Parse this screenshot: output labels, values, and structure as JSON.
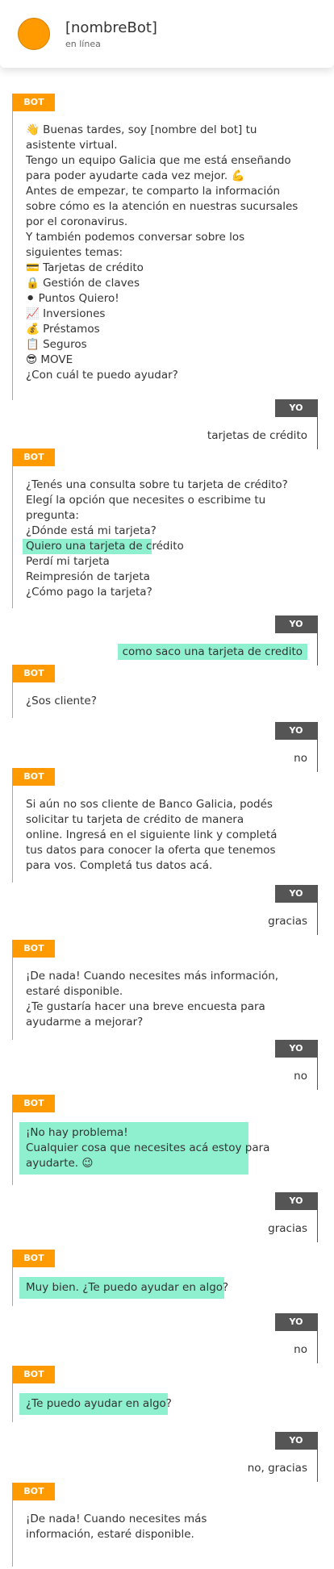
{
  "header": {
    "bot_name": "[nombreBot]",
    "status": "en línea"
  },
  "labels": {
    "bot": "BOT",
    "user": "YO"
  },
  "messages": {
    "m1": {
      "lines": [
        "👋 Buenas tardes, soy [nombre del bot] tu",
        "asistente virtual.",
        "Tengo un equipo Galicia que me está enseñando",
        "para poder ayudarte cada vez mejor. 💪",
        "Antes de empezar, te comparto la información",
        "sobre cómo es la atención en nuestras sucursales",
        "por el coronavirus.",
        "Y también podemos conversar sobre los",
        "siguientes temas:",
        "💳 Tarjetas de crédito",
        "🔒 Gestión de claves",
        "⚫ Puntos Quiero!",
        "📈 Inversiones",
        "💰 Préstamos",
        "📋 Seguros",
        "😎 MOVE",
        "¿Con cuál te puedo ayudar?"
      ]
    },
    "u1": {
      "text": "tarjetas de crédito"
    },
    "m2": {
      "lines": [
        "¿Tenés una consulta sobre tu tarjeta de crédito?",
        "Elegí la opción que necesites o escribime tu",
        "pregunta:",
        "¿Dónde está mi tarjeta?",
        "Quiero una tarjeta de crédito",
        "Perdí mi tarjeta",
        "Reimpresión de tarjeta",
        "¿Cómo pago la tarjeta?"
      ]
    },
    "u2": {
      "text": "como saco una tarjeta de credito"
    },
    "m3": {
      "lines": [
        "¿Sos cliente?"
      ]
    },
    "u3": {
      "text": "no"
    },
    "m4": {
      "lines": [
        "Si aún no sos cliente de Banco Galicia, podés",
        "solicitar tu tarjeta de crédito de manera",
        "online. Ingresá en el siguiente link y completá",
        "tus datos para conocer la oferta que tenemos",
        "para vos. Completá tus datos acá."
      ]
    },
    "u4": {
      "text": "gracias"
    },
    "m5": {
      "lines": [
        "¡De nada! Cuando necesites más información,",
        "estaré disponible.",
        "¿Te gustaría hacer una breve encuesta para",
        "ayudarme a mejorar?"
      ]
    },
    "u5": {
      "text": "no"
    },
    "m6": {
      "lines": [
        "¡No hay problema!",
        "Cualquier cosa que necesites acá estoy para",
        "ayudarte. 😉"
      ]
    },
    "u6": {
      "text": "gracias"
    },
    "m7": {
      "lines": [
        "Muy bien. ¿Te puedo ayudar en algo?"
      ]
    },
    "u7": {
      "text": "no"
    },
    "m8": {
      "lines": [
        "¿Te puedo ayudar en algo?"
      ]
    },
    "u8": {
      "text": "no, gracias"
    },
    "m9": {
      "lines": [
        "¡De nada! Cuando necesites más",
        "información, estaré disponible."
      ]
    }
  },
  "colors": {
    "bot_accent": "#ff9a00",
    "user_accent": "#555555",
    "highlight": "#8ef0cf"
  }
}
